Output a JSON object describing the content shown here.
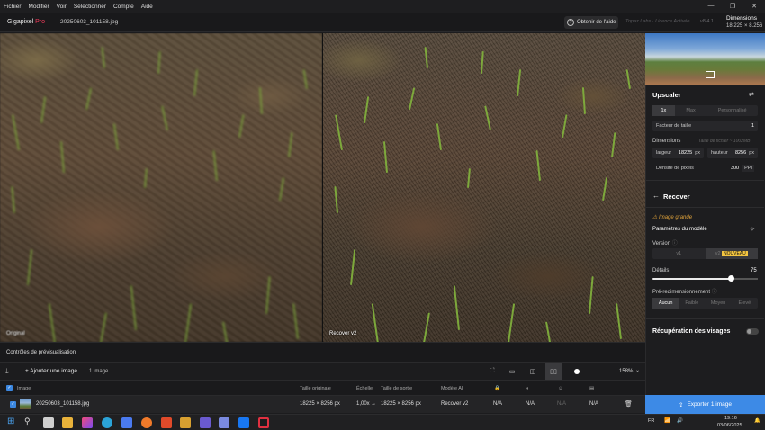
{
  "menu": {
    "items": [
      "Fichier",
      "Modifier",
      "Voir",
      "Sélectionner",
      "Compte",
      "Aide"
    ]
  },
  "window_controls": {
    "minimize": "—",
    "maximize": "❐",
    "close": "✕"
  },
  "header": {
    "app": "Gigapixel",
    "app_tier": "Pro",
    "filename": "20250603_101158.jpg",
    "help": "Obtenir de l'aide",
    "dim_title": "Dimensions",
    "dim_value": "18.225 × 8.256",
    "topaz_label": "Topaz Labs · Licence Activée",
    "version": "v8.4.1"
  },
  "viewer": {
    "left_label": "Original",
    "right_label": "Recover v2"
  },
  "preview_controls": {
    "label": "Contrôles de prévisualisation"
  },
  "toolbar": {
    "add_image": "Ajouter une image",
    "count": "1 image",
    "zoom": "158%"
  },
  "table": {
    "headers": {
      "image": "Image",
      "original": "Taille originale",
      "scale": "Échelle",
      "output": "Taille de sortie",
      "model": "Modèle AI"
    },
    "rows": [
      {
        "name": "20250603_101158.jpg",
        "original": "18225 × 8256 px",
        "scale": "1,00x",
        "output": "18225 × 8256 px",
        "model": "Recover v2",
        "c1": "N/A",
        "c2": "N/A",
        "c3": "N/A",
        "c4": "N/A"
      }
    ]
  },
  "side": {
    "upscaler": "Upscaler",
    "modes": [
      "1x",
      "Max",
      "Personnalisé"
    ],
    "factor_label": "Facteur de taille",
    "factor_value": "1",
    "dimensions_label": "Dimensions",
    "file_size": "Taille de fichier ~ 1002MB",
    "width_label": "largeur",
    "width_value": "18225",
    "width_unit": "px",
    "height_label": "hauteur",
    "height_value": "8256",
    "height_unit": "px",
    "density_label": "Densité de pixels",
    "density_value": "300",
    "density_unit": "PPI",
    "recover": "Recover",
    "warning": "Image grande",
    "model_params": "Paramètres du modèle",
    "version_label": "Version",
    "versions": [
      "v1",
      "v2"
    ],
    "new_badge": "NOUVEAU",
    "details_label": "Détails",
    "details_value": "75",
    "resize_label": "Pré-redimensionnement",
    "resize_opts": [
      "Aucun",
      "Faible",
      "Moyen",
      "Élevé"
    ],
    "faces_label": "Récupération des visages"
  },
  "export": {
    "label": "Exporter 1 image"
  },
  "taskbar": {
    "lang": "FR",
    "time": "19:16",
    "date": "03/06/2025"
  }
}
